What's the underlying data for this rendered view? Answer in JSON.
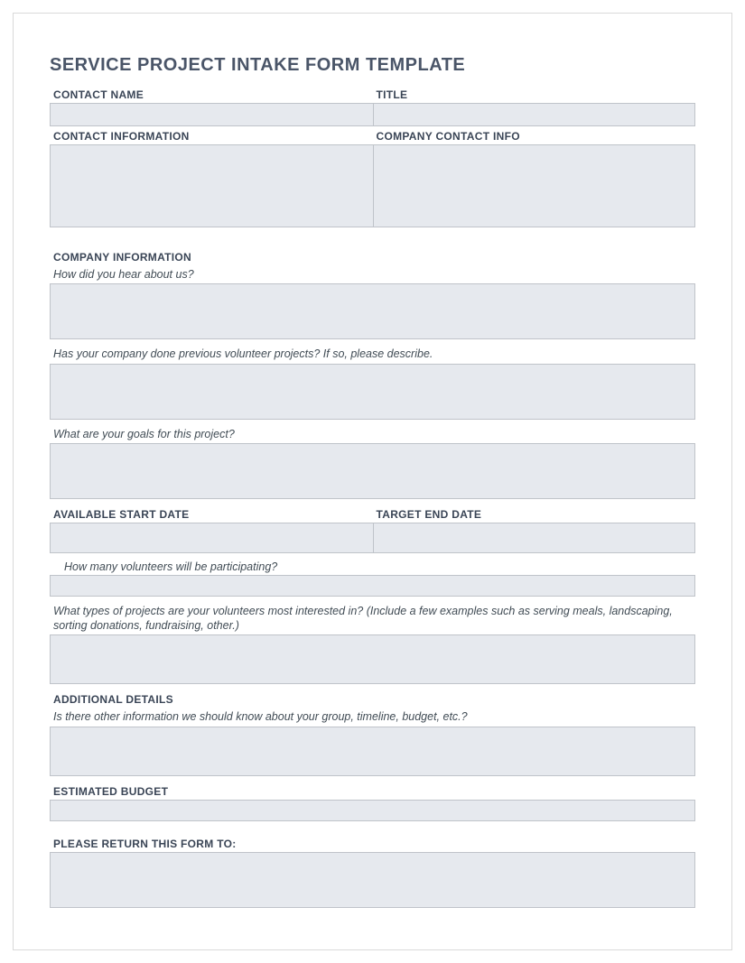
{
  "title": "SERVICE PROJECT INTAKE FORM TEMPLATE",
  "contact": {
    "name_label": "CONTACT NAME",
    "title_label": "TITLE",
    "info_label": "CONTACT INFORMATION",
    "company_info_label": "COMPANY CONTACT INFO",
    "name_value": "",
    "title_value": "",
    "info_value": "",
    "company_info_value": ""
  },
  "company": {
    "section_label": "COMPANY INFORMATION",
    "q_hear_about": "How did you hear about us?",
    "q_previous": "Has your company done previous volunteer projects? If so, please describe.",
    "q_goals": "What are your goals for this project?",
    "hear_value": "",
    "previous_value": "",
    "goals_value": ""
  },
  "dates": {
    "start_label": "AVAILABLE START DATE",
    "end_label": "TARGET END DATE",
    "start_value": "",
    "end_value": ""
  },
  "volunteers": {
    "q_count": "How many volunteers will be participating?",
    "q_interests": "What types of projects are your volunteers most interested in? (Include a few examples such as serving meals, landscaping, sorting donations, fundraising, other.)",
    "count_value": "",
    "interests_value": ""
  },
  "additional": {
    "section_label": "ADDITIONAL DETAILS",
    "q_other": "Is there other information we should know about your group, timeline, budget, etc.?",
    "other_value": ""
  },
  "budget": {
    "label": "ESTIMATED BUDGET",
    "value": ""
  },
  "return": {
    "label": "PLEASE RETURN THIS FORM TO:",
    "value": ""
  }
}
